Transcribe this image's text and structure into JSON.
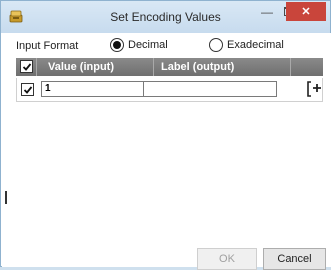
{
  "window": {
    "title": "Set Encoding Values",
    "icons": {
      "app": "app-icon",
      "minimize": "minimize-icon",
      "maximize": "maximize-icon",
      "close": "close-icon"
    },
    "close_label": "✕"
  },
  "input_format": {
    "label": "Input Format",
    "options": [
      {
        "label": "Decimal",
        "selected": true
      },
      {
        "label": "Exadecimal",
        "selected": false
      }
    ]
  },
  "table": {
    "headers": {
      "value": "Value (input)",
      "label": "Label (output)"
    },
    "header_checked": true,
    "rows": [
      {
        "checked": true,
        "value": "1",
        "label": ""
      }
    ],
    "add_icon": "add-row-icon"
  },
  "buttons": {
    "ok": "OK",
    "cancel": "Cancel"
  },
  "colors": {
    "close_button": "#c9453b",
    "header_bg": "#7c7c7c",
    "titlebar": "#cfe0ee"
  }
}
